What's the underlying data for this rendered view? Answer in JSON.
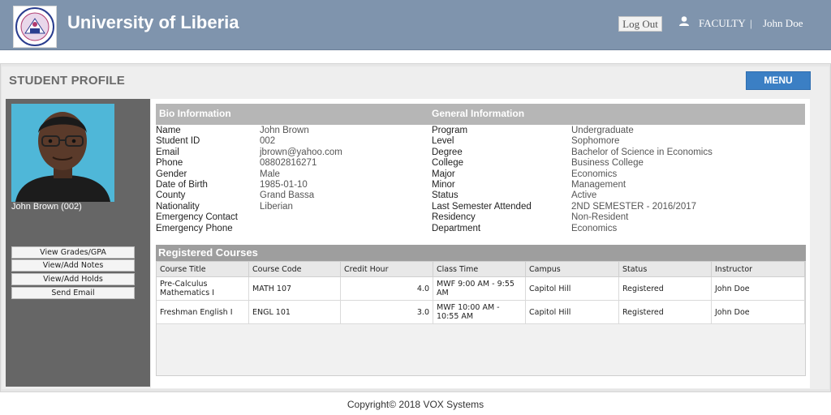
{
  "header": {
    "app_title": "University of Liberia",
    "logout_label": "Log Out",
    "role": "FACULTY",
    "separator": "|",
    "user_name": "John  Doe",
    "logo_text": [
      "UNIVERSITY OF LIBERIA",
      "LIBERIA COLLEGE"
    ]
  },
  "page": {
    "title": "STUDENT PROFILE",
    "menu_label": "MENU"
  },
  "sidebar": {
    "student_caption": "John Brown (002)",
    "buttons": [
      "View Grades/GPA",
      "View/Add Notes",
      "View/Add Holds",
      "Send Email"
    ]
  },
  "bio": {
    "header": "Bio Information",
    "fields": [
      {
        "label": "Name",
        "value": "John Brown"
      },
      {
        "label": "Student ID",
        "value": "002"
      },
      {
        "label": "Email",
        "value": "jbrown@yahoo.com"
      },
      {
        "label": "Phone",
        "value": "08802816271"
      },
      {
        "label": "Gender",
        "value": "Male"
      },
      {
        "label": "Date of Birth",
        "value": "1985-01-10"
      },
      {
        "label": "County",
        "value": "Grand Bassa"
      },
      {
        "label": "Nationality",
        "value": "Liberian"
      },
      {
        "label": "Emergency Contact",
        "value": ""
      },
      {
        "label": "Emergency Phone",
        "value": ""
      }
    ]
  },
  "general": {
    "header": "General Information",
    "fields": [
      {
        "label": "Program",
        "value": "Undergraduate"
      },
      {
        "label": "Level",
        "value": "Sophomore"
      },
      {
        "label": "Degree",
        "value": "Bachelor of Science in Economics"
      },
      {
        "label": "College",
        "value": "Business College"
      },
      {
        "label": "Major",
        "value": "Economics"
      },
      {
        "label": "Minor",
        "value": "Management"
      },
      {
        "label": "Status",
        "value": "Active"
      },
      {
        "label": "Last Semester Attended",
        "value": "2ND SEMESTER - 2016/2017"
      },
      {
        "label": "Residency",
        "value": "Non-Resident"
      },
      {
        "label": "Department",
        "value": "Economics"
      }
    ]
  },
  "courses": {
    "title": "Registered Courses",
    "columns": [
      "Course Title",
      "Course Code",
      "Credit Hour",
      "Class Time",
      "Campus",
      "Status",
      "Instructor"
    ],
    "rows": [
      [
        "Pre-Calculus Mathematics I",
        "MATH 107",
        "4.0",
        "MWF 9:00 AM - 9:55 AM",
        "Capitol Hill",
        "Registered",
        "John Doe"
      ],
      [
        "Freshman English I",
        "ENGL 101",
        "3.0",
        "MWF 10:00 AM - 10:55 AM",
        "Capitol Hill",
        "Registered",
        "John Doe"
      ]
    ]
  },
  "footer": {
    "copyright": "Copyright© 2018 VOX Systems"
  },
  "colors": {
    "header_bg": "#7f94ad",
    "menu_button": "#3b7fc4",
    "sidebar_bg": "#666666",
    "section_header": "#b6b6b6",
    "courses_header": "#9e9e9e"
  }
}
